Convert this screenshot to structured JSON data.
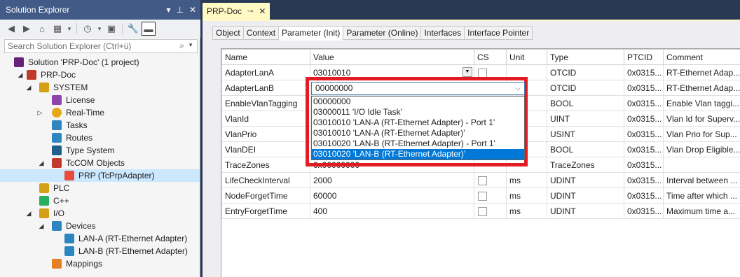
{
  "solution_explorer": {
    "title": "Solution Explorer",
    "title_icons": [
      "▾",
      "⊥",
      "✕"
    ],
    "search_placeholder": "Search Solution Explorer (Ctrl+ü)",
    "tree": [
      {
        "label": "Solution 'PRP-Doc' (1 project)",
        "icon": "solution-icon",
        "color": "#68217a"
      },
      {
        "label": "PRP-Doc",
        "icon": "project-icon",
        "color": "#c0392b",
        "expander": "◢"
      },
      {
        "label": "SYSTEM",
        "icon": "system-icon",
        "color": "#d4a017",
        "expander": "◢"
      },
      {
        "label": "License",
        "icon": "license-icon",
        "color": "#8e44ad"
      },
      {
        "label": "Real-Time",
        "icon": "realtime-icon",
        "color": "#e6a817",
        "expander": "▷"
      },
      {
        "label": "Tasks",
        "icon": "tasks-icon",
        "color": "#2e86c1"
      },
      {
        "label": "Routes",
        "icon": "routes-icon",
        "color": "#2e86c1"
      },
      {
        "label": "Type System",
        "icon": "type-system-icon",
        "color": "#1f618d"
      },
      {
        "label": "TcCOM Objects",
        "icon": "tccom-icon",
        "color": "#c0392b",
        "expander": "◢"
      },
      {
        "label": "PRP (TcPrpAdapter)",
        "icon": "prp-icon",
        "color": "#e74c3c",
        "selected": true
      },
      {
        "label": "PLC",
        "icon": "plc-icon",
        "color": "#d4a017"
      },
      {
        "label": "C++",
        "icon": "cpp-icon",
        "color": "#27ae60"
      },
      {
        "label": "I/O",
        "icon": "io-icon",
        "color": "#d4a017",
        "expander": "◢"
      },
      {
        "label": "Devices",
        "icon": "devices-icon",
        "color": "#2e86c1",
        "expander": "◢"
      },
      {
        "label": "LAN-A (RT-Ethernet Adapter)",
        "icon": "ethernet-adapter-icon",
        "color": "#2e86c1"
      },
      {
        "label": "LAN-B (RT-Ethernet Adapter)",
        "icon": "ethernet-adapter-icon",
        "color": "#2e86c1"
      },
      {
        "label": "Mappings",
        "icon": "mappings-icon",
        "color": "#e67e22"
      }
    ]
  },
  "document": {
    "tab_title": "PRP-Doc",
    "tabs": [
      "Object",
      "Context",
      "Parameter (Init)",
      "Parameter (Online)",
      "Interfaces",
      "Interface Pointer"
    ],
    "active_tab": "Parameter (Init)",
    "columns": [
      "Name",
      "Value",
      "CS",
      "Unit",
      "Type",
      "PTCID",
      "Comment"
    ],
    "rows": [
      {
        "name": "AdapterLanA",
        "value": "03010010",
        "cs": true,
        "unit": "",
        "type": "OTCID",
        "ptcid": "0x0315...",
        "comment": "RT-Ethernet Adap..."
      },
      {
        "name": "AdapterLanB",
        "value": "",
        "cs": false,
        "unit": "",
        "type": "OTCID",
        "ptcid": "0x0315...",
        "comment": "RT-Ethernet Adap..."
      },
      {
        "name": "EnableVlanTagging",
        "value": "",
        "cs": false,
        "unit": "",
        "type": "BOOL",
        "ptcid": "0x0315...",
        "comment": "Enable Vlan taggi..."
      },
      {
        "name": "VlanId",
        "value": "",
        "cs": false,
        "unit": "",
        "type": "UINT",
        "ptcid": "0x0315...",
        "comment": "Vlan Id for Superv..."
      },
      {
        "name": "VlanPrio",
        "value": "",
        "cs": false,
        "unit": "",
        "type": "USINT",
        "ptcid": "0x0315...",
        "comment": "Vlan Prio for Sup..."
      },
      {
        "name": "VlanDEI",
        "value": "",
        "cs": false,
        "unit": "",
        "type": "BOOL",
        "ptcid": "0x0315...",
        "comment": "Vlan Drop Eligible..."
      },
      {
        "name": "TraceZones",
        "value": "0x00000000",
        "cs": false,
        "unit": "",
        "type": "TraceZones",
        "ptcid": "0x0315...",
        "comment": ""
      },
      {
        "name": "LifeCheckInterval",
        "value": "2000",
        "cs": true,
        "unit": "ms",
        "type": "UDINT",
        "ptcid": "0x0315...",
        "comment": "Interval between ..."
      },
      {
        "name": "NodeForgetTime",
        "value": "60000",
        "cs": true,
        "unit": "ms",
        "type": "UDINT",
        "ptcid": "0x0315...",
        "comment": "Time after which ..."
      },
      {
        "name": "EntryForgetTime",
        "value": "400",
        "cs": true,
        "unit": "ms",
        "type": "UDINT",
        "ptcid": "0x0315...",
        "comment": "Maximum time a..."
      }
    ],
    "dropdown": {
      "current_value": "00000000",
      "options": [
        "00000000",
        "03000011 'I/O Idle Task'",
        "03010010 'LAN-A (RT-Ethernet Adapter) - Port 1'",
        "03010010 'LAN-A (RT-Ethernet Adapter)'",
        "03010020 'LAN-B (RT-Ethernet Adapter) - Port 1'",
        "03010020 'LAN-B (RT-Ethernet Adapter)'"
      ],
      "selected_index": 5,
      "highlight_color": "#e31b23"
    }
  }
}
